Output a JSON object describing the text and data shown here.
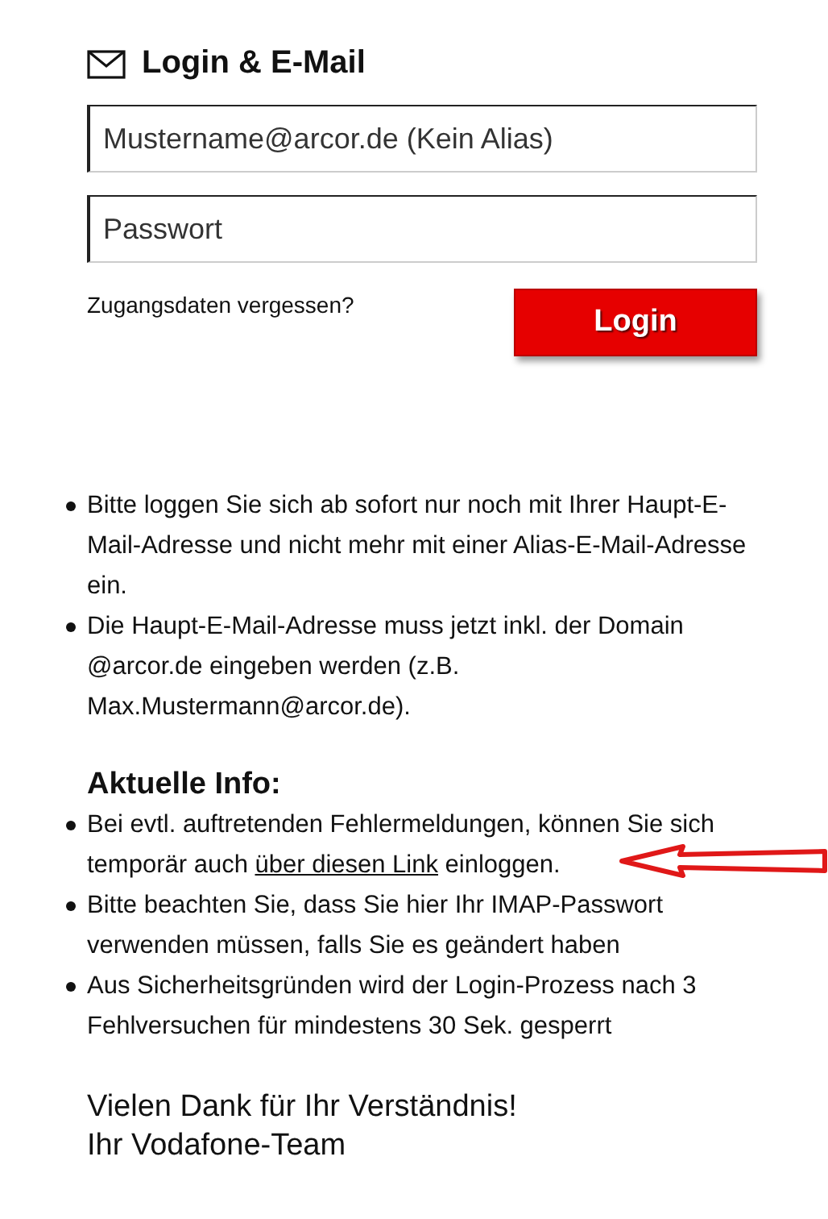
{
  "login": {
    "title": "Login & E-Mail",
    "email_placeholder": "Mustername@arcor.de (Kein Alias)",
    "password_placeholder": "Passwort",
    "forgot_link": "Zugangsdaten vergessen?",
    "login_button": "Login"
  },
  "notes": [
    {
      "segments": [
        {
          "text": "Bitte loggen Sie sich ab sofort nur noch mit Ihrer Haupt-E-Mail-Adresse und nicht mehr mit einer Alias-E-Mail-Adresse ein.",
          "link": false
        }
      ]
    },
    {
      "segments": [
        {
          "text": "Die Haupt-E-Mail-Adresse muss jetzt inkl. der Domain @arcor.de eingeben werden (z.B. Max.Mustermann@arcor.de).",
          "link": false
        }
      ]
    }
  ],
  "info": {
    "title": "Aktuelle Info:",
    "items": [
      {
        "segments": [
          {
            "text": "Bei evtl. auftretenden Fehlermeldungen, können Sie sich temporär auch ",
            "link": false
          },
          {
            "text": "über diesen Link",
            "link": true
          },
          {
            "text": " einloggen.",
            "link": false
          }
        ],
        "arrow": true
      },
      {
        "segments": [
          {
            "text": "Bitte beachten Sie, dass Sie hier Ihr IMAP-Passwort verwenden müssen, falls Sie es geändert haben",
            "link": false
          }
        ],
        "arrow": false
      },
      {
        "segments": [
          {
            "text": "Aus Sicherheitsgründen wird der Login-Prozess nach 3 Fehlversuchen für mindestens 30 Sek. gesperrt",
            "link": false
          }
        ],
        "arrow": false
      }
    ]
  },
  "closing": [
    "Vielen Dank für Ihr Verständnis!",
    "Ihr Vodafone-Team"
  ]
}
